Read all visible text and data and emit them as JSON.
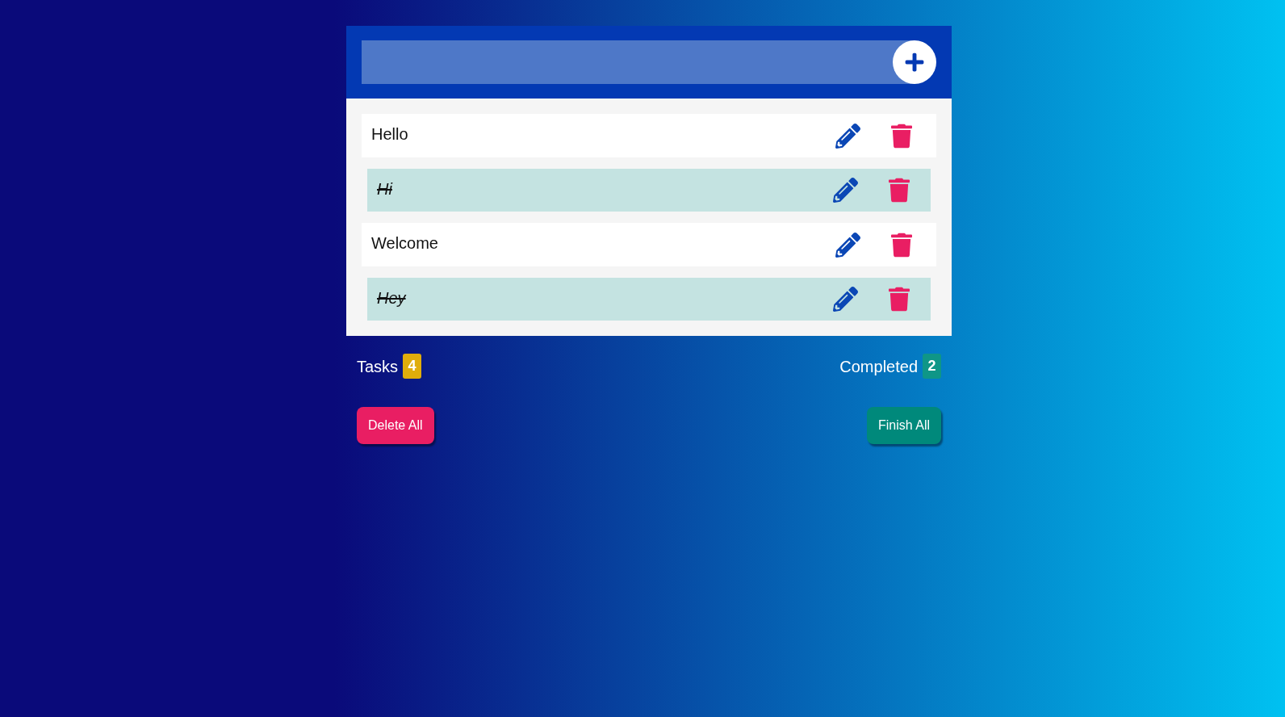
{
  "tasks": [
    {
      "text": "Hello",
      "completed": false
    },
    {
      "text": "Hi",
      "completed": true
    },
    {
      "text": "Welcome",
      "completed": false
    },
    {
      "text": "Hey",
      "completed": true
    }
  ],
  "stats": [
    {
      "label": "Tasks",
      "count": "4",
      "color": "#e0ad0b"
    },
    {
      "label": "Completed",
      "count": "2",
      "color": "#0f9687"
    }
  ],
  "buttons": [
    {
      "label": "Delete All",
      "color": "#e91e63"
    },
    {
      "label": "Finish All",
      "color": "#00897b"
    }
  ]
}
